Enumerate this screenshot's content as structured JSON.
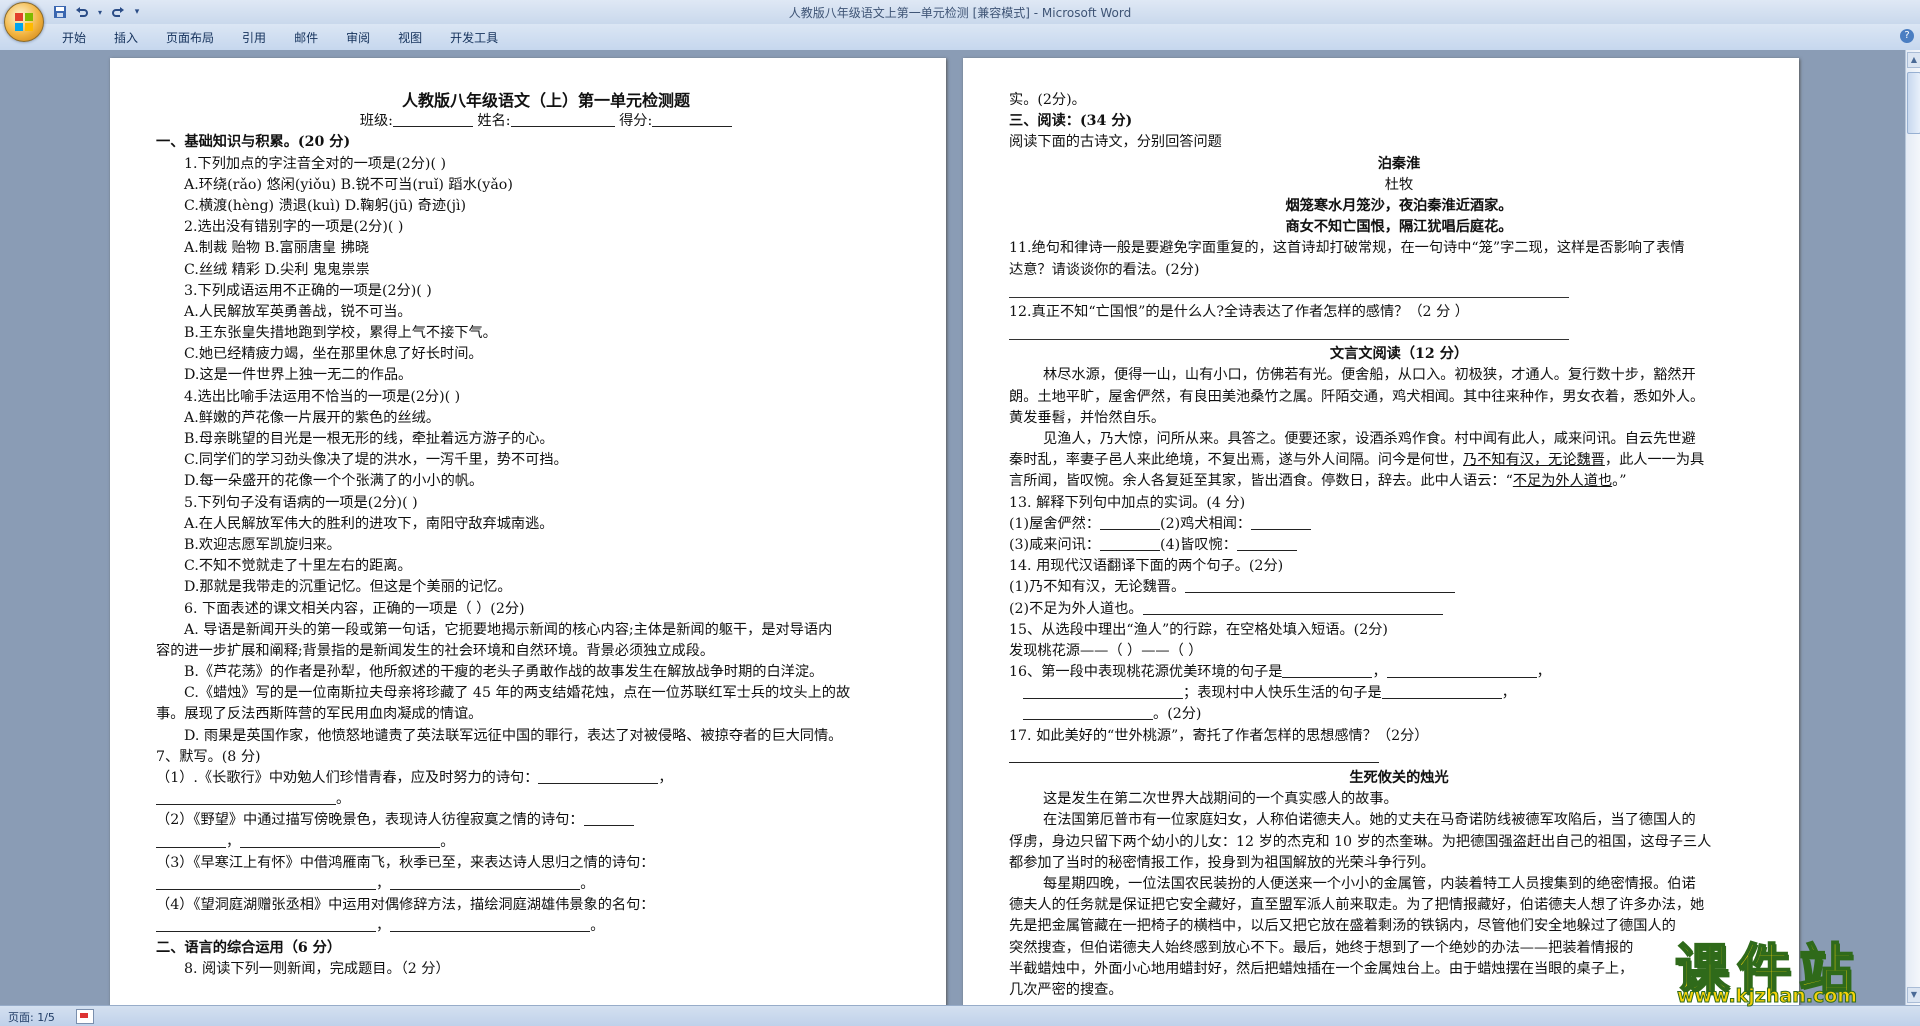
{
  "window": {
    "title": "人教版八年级语文上第一单元检测 [兼容模式] - Microsoft Word"
  },
  "qat": {
    "icons": [
      "word-logo-icon",
      "save-icon",
      "undo-icon",
      "redo-icon",
      "customize-icon"
    ]
  },
  "ribbon": {
    "tabs": [
      "开始",
      "插入",
      "页面布局",
      "引用",
      "邮件",
      "审阅",
      "视图",
      "开发工具"
    ]
  },
  "status": {
    "page_count": "页面: 1/5"
  },
  "watermark": {
    "text": "课件站",
    "url": "www.kjzhan.com"
  },
  "doc": {
    "left": {
      "title": "人教版八年级语文（上）第一单元检测题",
      "header_class": "班级:",
      "header_name": "姓名:",
      "header_score": "得分:",
      "section1": "一、基础知识与积累。(20 分)",
      "q1": "1.下列加点的字注音全对的一项是(2分)(      )",
      "q1a": "A.环绕(rǎo)    悠闲(yiǒu)    B.锐不可当(ruǐ)    蹈水(yǎo)",
      "q1b": "C.横渡(hèng)    溃退(kuì)    D.鞠躬(jū)         奇迹(jì)",
      "q2": "2.选出没有错别字的一项是(2分)(       )",
      "q2a": "A.制裁 贻物 B.富丽唐皇 拂晓",
      "q2b": "C.丝绒 精彩 D.尖利 鬼鬼祟祟",
      "q3": "3.下列成语运用不正确的一项是(2分)(         )",
      "q3a": "A.人民解放军英勇善战，锐不可当。",
      "q3b": "B.王东张皇失措地跑到学校，累得上气不接下气。",
      "q3c": "C.她已经精疲力竭，坐在那里休息了好长时间。",
      "q3d": "D.这是一件世界上独一无二的作品。",
      "q4": "4.选出比喻手法运用不恰当的一项是(2分)(      )",
      "q4a": "A.鲜嫩的芦花像一片展开的紫色的丝绒。",
      "q4b": "B.母亲眺望的目光是一根无形的线，牵扯着远方游子的心。",
      "q4c": "C.同学们的学习劲头像决了堤的洪水，一泻千里，势不可挡。",
      "q4d": "D.每一朵盛开的花像一个个张满了的小小的帆。",
      "q5": "5.下列句子没有语病的一项是(2分)(         )",
      "q5a": "A.在人民解放军伟大的胜利的进攻下，南阳守敌弃城南逃。",
      "q5b": "B.欢迎志愿军凯旋归来。",
      "q5c": "C.不知不觉就走了十里左右的距离。",
      "q5d": "D.那就是我带走的沉重记忆。但这是个美丽的记忆。",
      "q6": "6.  下面表述的课文相关内容，正确的一项是（       ）(2分)",
      "q6a1": "A.  导语是新闻开头的第一段或第一句话，它扼要地揭示新闻的核心内容;主体是新闻的躯干，是对导语内",
      "q6a2": "容的进一步扩展和阐释;背景指的是新闻发生的社会环境和自然环境。背景必须独立成段。",
      "q6b": "B.《芦花荡》的作者是孙犁，他所叙述的干瘦的老头子勇敢作战的故事发生在解放战争时期的白洋淀。",
      "q6c1": "C.《蜡烛》写的是一位南斯拉夫母亲将珍藏了  45 年的两支结婚花烛，点在一位苏联红军士兵的坟头上的故",
      "q6c2": "事。展现了反法西斯阵营的军民用血肉凝成的情谊。",
      "q6d": "D.  雨果是英国作家，他愤怒地谴责了英法联军远征中国的罪行，表达了对被侵略、被掠夺者的巨大同情。",
      "q7": "7、默写。(8 分)",
      "q7_1": "（1）.《长歌行》中劝勉人们珍惜青春，应及时努力的诗句：",
      "q7_2": "（2）《野望》中通过描写傍晚景色，表现诗人彷徨寂寞之情的诗句：",
      "q7_3": "（3）《早寒江上有怀》中借鸿雁南飞，秋季已至，来表达诗人思归之情的诗句：",
      "q7_4": "（4）《望洞庭湖赠张丞相》中运用对偶修辞方法，描绘洞庭湖雄伟景象的名句：",
      "section2": "二、语言的综合运用（6 分）",
      "q8": "8.  阅读下列一则新闻，完成题目。（2 分）"
    },
    "right": {
      "r0": "实。(2分)。",
      "section3": "三、阅读：(34 分)",
      "intro": "阅读下面的古诗文，分别回答问题",
      "poem_title": "泊秦淮",
      "poem_author": "杜牧",
      "poem_l1": "烟笼寒水月笼沙，夜泊秦淮近酒家。",
      "poem_l2": "商女不知亡国恨，隔江犹唱后庭花。",
      "q11a": "11.绝句和律诗一般是要避免字面重复的，这首诗却打破常规，在一句诗中“笼”字二现，这样是否影响了表情",
      "q11b": "达意？请谈谈你的看法。(2分)",
      "q12": "12.真正不知“亡国恨”的是什么人?全诗表达了作者怎样的感情？（2 分 ）",
      "wyw_title": "文言文阅读（12 分）",
      "p1a": "林尽水源，便得一山，山有小口，仿佛若有光。便舍船，从口入。初极狭，才通人。复行数十步，豁然开",
      "p1b": "朗。土地平旷，屋舍俨然，有良田美池桑竹之属。阡陌交通，鸡犬相闻。其中往来种作，男女衣着，悉如外人。",
      "p1c": "黄发垂髫，并怡然自乐。",
      "p2a": "见渔人，乃大惊，问所从来。具答之。便要还家，设酒杀鸡作食。村中闻有此人，咸来问讯。自云先世避",
      "p2b1": "秦时乱，率妻子邑人来此绝境，不复出焉，遂与外人间隔。问今是何世，",
      "p2b_u": "乃不知有汉，无论魏晋",
      "p2b2": "，此人一一为具",
      "p2c1": "言所闻，皆叹惋。余人各复延至其家，皆出酒食。停数日，辞去。此中人语云：“",
      "p2c_u": "不足为外人道也",
      "p2c2": "。”",
      "q13": "13.  解释下列句中加点的实词。(4 分)",
      "q13a": "(1)屋舍俨然：",
      "q13b": "(2)鸡犬相闻：",
      "q13c": "(3)咸来问讯：",
      "q13d": "(4)皆叹惋：",
      "q14": "14.  用现代汉语翻译下面的两个句子。(2分)",
      "q14a": "(1)乃不知有汉，无论魏晋。",
      "q14b": "(2)不足为外人道也。",
      "q15": "15、从选段中理出“渔人”的行踪，在空格处填入短语。(2分)",
      "q15a": "发现桃花源——（                ）——（              ）",
      "q16a": "16、第一段中表现桃花源优美环境的句子是",
      "q16b": "；表现村中人快乐生活的句子是",
      "q16c": "。(2分)",
      "q17": "17.  如此美好的“世外桃源”，寄托了作者怎样的思想感情？（2分）",
      "story_title": "生死攸关的烛光",
      "s1": "这是发生在第二次世界大战期间的一个真实感人的故事。",
      "s2a": "在法国第厄普市有一位家庭妇女，人称伯诺德夫人。她的丈夫在马奇诺防线被德军攻陷后，当了德国人的",
      "s2b": "俘虏，身边只留下两个幼小的儿女：12 岁的杰克和 10 岁的杰奎琳。为把德国强盗赶出自己的祖国，这母子三人",
      "s2c": "都参加了当时的秘密情报工作，投身到为祖国解放的光荣斗争行列。",
      "s3a": "每星期四晚，一位法国农民装扮的人便送来一个小小的金属管，内装着特工人员搜集到的绝密情报。伯诺",
      "s3b": "德夫人的任务就是保证把它安全藏好，直至盟军派人前来取走。为了把情报藏好，伯诺德夫人想了许多办法，她",
      "s3c": "先是把金属管藏在一把椅子的横档中，以后又把它放在盛着剩汤的铁锅内，尽管他们安全地躲过了德国人的",
      "s3d": "突然搜查，但伯诺德夫人始终感到放心不下。最后，她终于想到了一个绝妙的办法——把装着情报的",
      "s3e": "半截蜡烛中，外面小心地用蜡封好，然后把蜡烛插在一个金属烛台上。由于蜡烛摆在当眼的桌子上，",
      "s3f": "几次严密的搜查。"
    }
  }
}
